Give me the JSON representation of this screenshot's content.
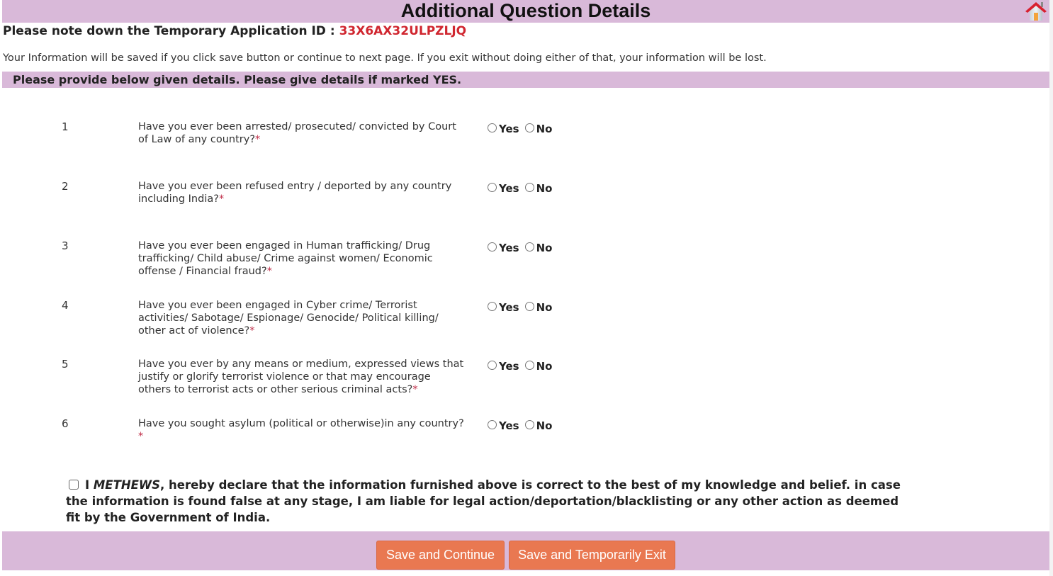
{
  "header": {
    "title": "Additional Question Details",
    "home_icon": "home-icon"
  },
  "application": {
    "id_label": "Please note down the Temporary Application ID : ",
    "id_value": "33X6AX32ULPZLJQ"
  },
  "notice": "Your Information will be saved if you click save button or continue to next page. If you exit without doing either of that, your information will be lost.",
  "section": {
    "heading": "Please provide below given details. Please give details if marked YES."
  },
  "questions": [
    {
      "number": "1",
      "text": "Have you ever been arrested/ prosecuted/ convicted by Court of Law of any country?",
      "required": "*",
      "options": [
        "Yes",
        "No"
      ],
      "selected": null
    },
    {
      "number": "2",
      "text": "Have you ever been refused entry / deported by any country including India?",
      "required": "*",
      "options": [
        "Yes",
        "No"
      ],
      "selected": null
    },
    {
      "number": "3",
      "text": "Have you ever been engaged in Human trafficking/ Drug trafficking/ Child abuse/ Crime against women/ Economic offense / Financial fraud?",
      "required": "*",
      "options": [
        "Yes",
        "No"
      ],
      "selected": null
    },
    {
      "number": "4",
      "text": "Have you ever been engaged in Cyber crime/ Terrorist activities/ Sabotage/ Espionage/ Genocide/ Political killing/ other act of violence?",
      "required": "*",
      "options": [
        "Yes",
        "No"
      ],
      "selected": null
    },
    {
      "number": "5",
      "text": "Have you ever by any means or medium, expressed views that justify or glorify terrorist violence or that may encourage others to terrorist acts or other serious criminal acts?",
      "required": "*",
      "options": [
        "Yes",
        "No"
      ],
      "selected": null
    },
    {
      "number": "6",
      "text": "Have you sought asylum (political or otherwise)in any country?",
      "required": "*",
      "options": [
        "Yes",
        "No"
      ],
      "selected": null
    }
  ],
  "declaration": {
    "checked": false,
    "prefix": "I ",
    "name": "METHEWS",
    "text": ", hereby declare that the information furnished above is correct to the best of my knowledge and belief. in case the information is found false at any stage, I am liable for legal action/deportation/blacklisting or any other action as deemed fit by the Government of India."
  },
  "buttons": {
    "save_continue": "Save and Continue",
    "save_exit": "Save and Temporarily Exit"
  },
  "colors": {
    "header_bg": "#d9b9d9",
    "id_color": "#d0262f",
    "button_bg": "#e97851"
  }
}
